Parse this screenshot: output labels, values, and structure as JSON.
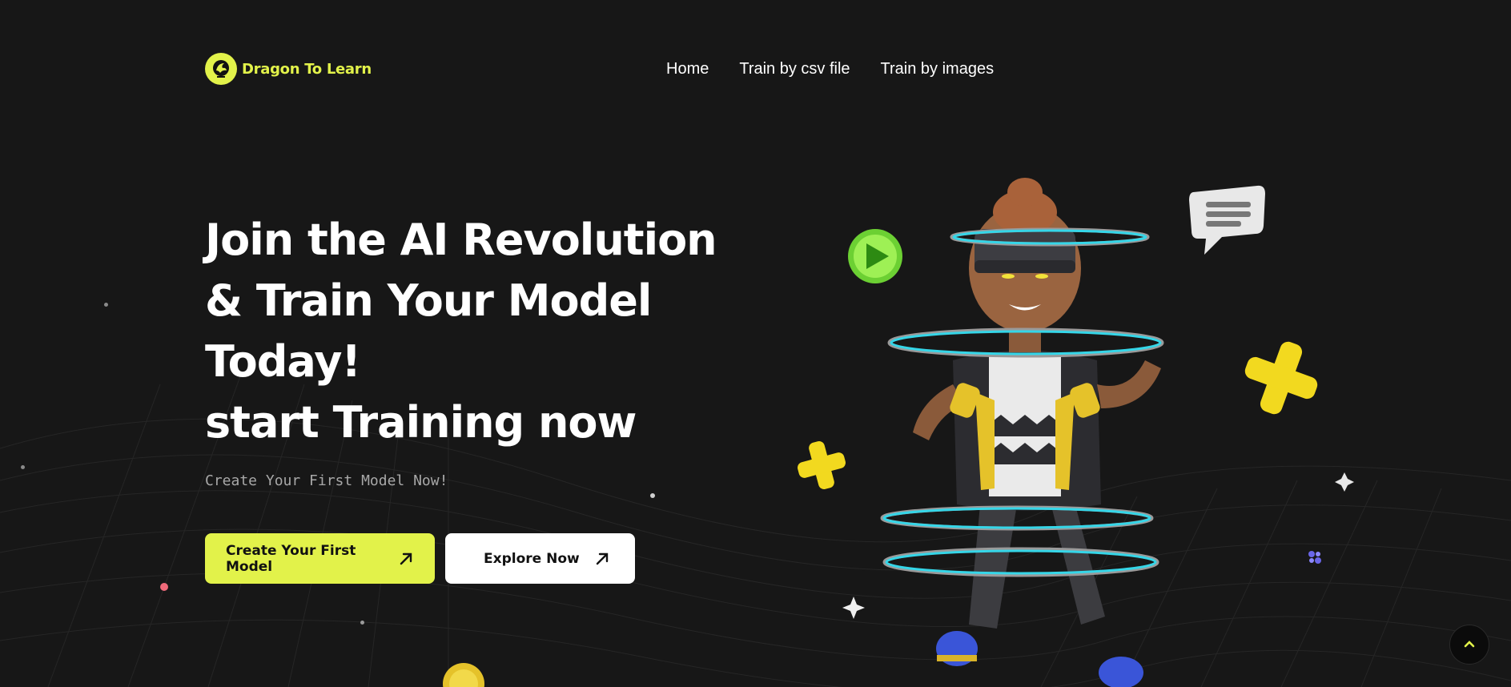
{
  "brand": {
    "name": "Dragon To Learn",
    "accent_color": "#e2f24a",
    "logo_icon": "dragon-icon"
  },
  "nav": {
    "items": [
      {
        "label": "Home"
      },
      {
        "label": "Train by csv file"
      },
      {
        "label": "Train by images"
      }
    ]
  },
  "hero": {
    "headline_line1": "Join the AI Revolution",
    "headline_line2": "& Train Your Model",
    "headline_line3": "Today!",
    "headline_line4": "start Training now",
    "subtitle": "Create Your First Model Now!",
    "primary_button": {
      "label": "Create Your First Model",
      "icon": "arrow-up-right-icon"
    },
    "secondary_button": {
      "label": "Explore Now",
      "icon": "arrow-up-right-icon"
    }
  },
  "scroll_top": {
    "icon": "chevron-up-icon"
  },
  "colors": {
    "background": "#171717",
    "ring_cyan": "#35d6e8",
    "play_green": "#7ee03a",
    "shape_yellow": "#f2d91f"
  }
}
